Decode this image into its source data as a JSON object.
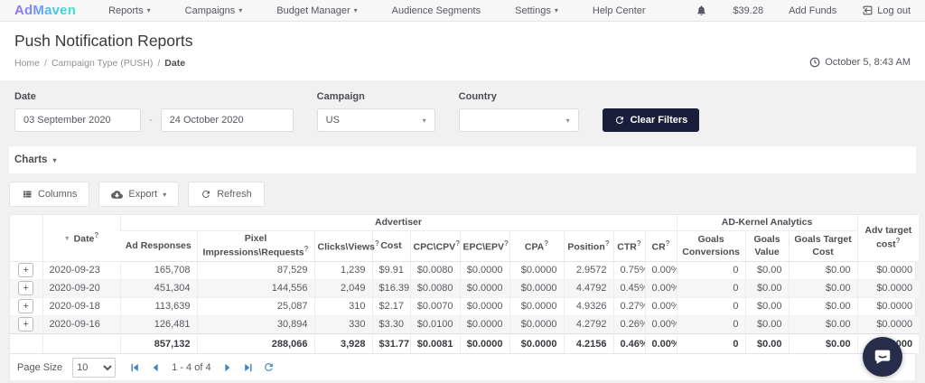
{
  "nav": {
    "logo_text": "AdMaven",
    "items": [
      {
        "label": "Reports",
        "caret": true
      },
      {
        "label": "Campaigns",
        "caret": true
      },
      {
        "label": "Budget Manager",
        "caret": true
      },
      {
        "label": "Audience Segments",
        "caret": false
      },
      {
        "label": "Settings",
        "caret": true
      },
      {
        "label": "Help Center",
        "caret": false
      }
    ],
    "balance": "$39.28",
    "add_funds_label": "Add Funds",
    "logout_label": "Log out"
  },
  "header": {
    "title": "Push Notification Reports",
    "breadcrumb": {
      "home": "Home",
      "middle": "Campaign Type (PUSH)",
      "current": "Date"
    },
    "datetime": "October 5, 8:43 AM"
  },
  "filters": {
    "date_label": "Date",
    "date_from": "03 September 2020",
    "date_separator": "-",
    "date_to": "24 October 2020",
    "campaign_label": "Campaign",
    "campaign_value": "US",
    "country_label": "Country",
    "country_value": "",
    "clear_button_label": "Clear Filters"
  },
  "charts": {
    "label": "Charts"
  },
  "toolbar": {
    "columns_label": "Columns",
    "export_label": "Export",
    "refresh_label": "Refresh"
  },
  "table": {
    "group_advertiser": "Advertiser",
    "group_adkernel": "AD-Kernel Analytics",
    "columns": [
      {
        "key": "date",
        "label": "Date",
        "help": true
      },
      {
        "key": "ad_responses",
        "label": "Ad Responses",
        "help": false
      },
      {
        "key": "pixel_impressions_requests",
        "label": "Pixel Impressions\\Requests",
        "help": true
      },
      {
        "key": "clicks_views",
        "label": "Clicks\\Views",
        "help": true
      },
      {
        "key": "cost",
        "label": "Cost",
        "help": false
      },
      {
        "key": "cpc_cpv",
        "label": "CPC\\CPV",
        "help": true
      },
      {
        "key": "epc_epv",
        "label": "EPC\\EPV",
        "help": true
      },
      {
        "key": "cpa",
        "label": "CPA",
        "help": true
      },
      {
        "key": "position",
        "label": "Position",
        "help": true
      },
      {
        "key": "ctr",
        "label": "CTR",
        "help": true
      },
      {
        "key": "cr",
        "label": "CR",
        "help": true
      },
      {
        "key": "goals_conversions",
        "label": "Goals Conversions",
        "help": false
      },
      {
        "key": "goals_value",
        "label": "Goals Value",
        "help": false
      },
      {
        "key": "goals_target_cost",
        "label": "Goals Target Cost",
        "help": false
      },
      {
        "key": "adv_target_cost",
        "label": "Adv target cost",
        "help": true
      }
    ],
    "rows": [
      [
        "2020-09-23",
        "165,708",
        "87,529",
        "1,239",
        "$9.91",
        "$0.0080",
        "$0.0000",
        "$0.0000",
        "2.9572",
        "0.75%",
        "0.00%",
        "0",
        "$0.00",
        "$0.00",
        "$0.0000"
      ],
      [
        "2020-09-20",
        "451,304",
        "144,556",
        "2,049",
        "$16.39",
        "$0.0080",
        "$0.0000",
        "$0.0000",
        "4.4792",
        "0.45%",
        "0.00%",
        "0",
        "$0.00",
        "$0.00",
        "$0.0000"
      ],
      [
        "2020-09-18",
        "113,639",
        "25,087",
        "310",
        "$2.17",
        "$0.0070",
        "$0.0000",
        "$0.0000",
        "4.9326",
        "0.27%",
        "0.00%",
        "0",
        "$0.00",
        "$0.00",
        "$0.0000"
      ],
      [
        "2020-09-16",
        "126,481",
        "30,894",
        "330",
        "$3.30",
        "$0.0100",
        "$0.0000",
        "$0.0000",
        "4.2792",
        "0.26%",
        "0.00%",
        "0",
        "$0.00",
        "$0.00",
        "$0.0000"
      ]
    ],
    "totals": [
      "",
      "857,132",
      "288,066",
      "3,928",
      "$31.77",
      "$0.0081",
      "$0.0000",
      "$0.0000",
      "4.2156",
      "0.46%",
      "0.00%",
      "0",
      "$0.00",
      "$0.00",
      "$0.0000"
    ]
  },
  "pagination": {
    "page_size_label": "Page Size",
    "page_size": "10",
    "range": "1 - 4 of 4"
  },
  "icons": {
    "caret_down": "▾",
    "sort_desc": "▼",
    "help_symbol": "?",
    "plus": "+",
    "breadcrumb_sep": "/"
  },
  "colors": {
    "accent_dark_navy": "#191f3a",
    "pager_blue": "#3c86c5",
    "logo_gradient_start": "#9c6bf3",
    "logo_gradient_end": "#3ae7c0",
    "chat_bubble": "#272c4b"
  }
}
